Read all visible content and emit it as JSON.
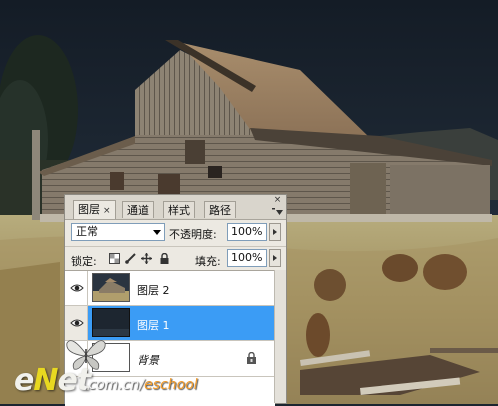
{
  "panel": {
    "tabs": [
      {
        "label": "图层",
        "active": true,
        "close_glyph": "×"
      },
      {
        "label": "通道"
      },
      {
        "label": "样式"
      },
      {
        "label": "路径"
      }
    ],
    "close_glyph": "×",
    "blend_mode": "正常",
    "opacity_label": "不透明度:",
    "opacity_value": "100%",
    "lock_label": "锁定:",
    "fill_label": "填充:",
    "fill_value": "100%",
    "layers": [
      {
        "name": "图层 2",
        "visible": true,
        "selected": false,
        "thumb": "barn-photo"
      },
      {
        "name": "图层 1",
        "visible": true,
        "selected": true,
        "thumb": "dark-sky"
      },
      {
        "name": "背景",
        "visible": false,
        "selected": false,
        "thumb": "white",
        "locked": true
      }
    ]
  },
  "watermark": {
    "logo_e": "e",
    "logo_n": "N",
    "logo_rest": "et",
    "url_main": ".com.cn/",
    "url_accent": "eschool"
  },
  "colors": {
    "selected_row": "#3b9cf5",
    "panel_bg": "#ece9e2",
    "watermark_accent": "#f29b2a"
  }
}
